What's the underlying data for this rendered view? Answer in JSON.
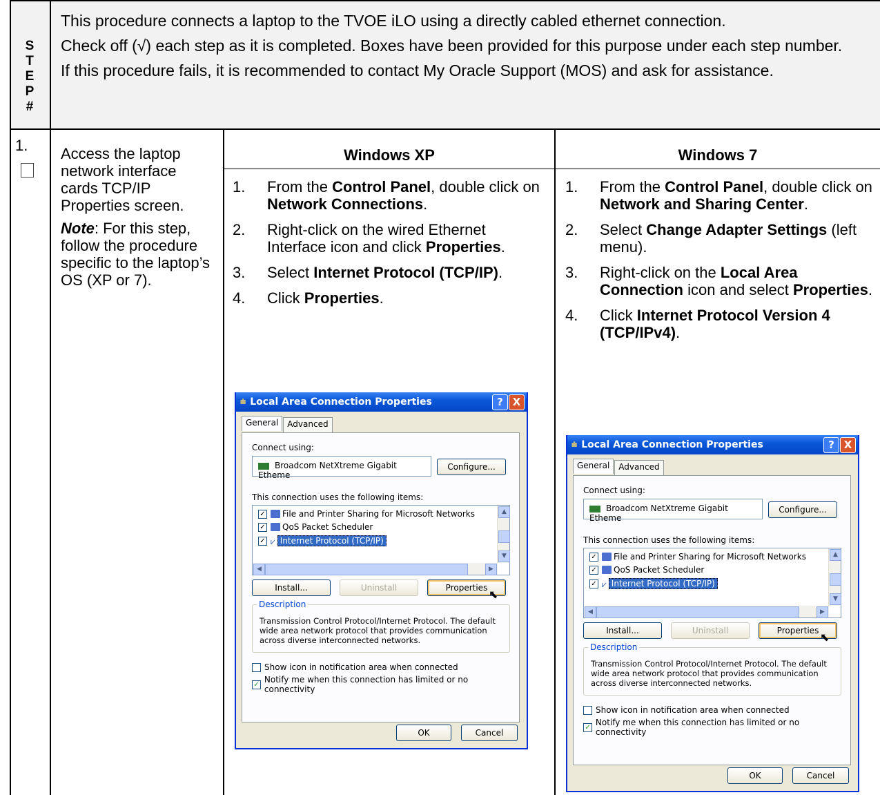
{
  "header": {
    "step_letters": [
      "S",
      "T",
      "E",
      "P",
      "#"
    ],
    "intro": [
      "This procedure connects a laptop to the TVOE iLO using a directly cabled ethernet connection.",
      "Check off (√) each step as it is completed.  Boxes have been provided for this purpose under each step number.",
      "If this procedure fails, it is recommended to contact My Oracle Support (MOS) and ask for assistance."
    ]
  },
  "step": {
    "number": "1.",
    "task": "Access the laptop network interface cards TCP/IP Properties screen.",
    "note_label": "Note",
    "note_text": ":    For this step, follow the procedure specific to the laptop’s OS (XP or 7)."
  },
  "xp": {
    "title": "Windows XP",
    "steps": [
      {
        "n": "1.",
        "parts": [
          [
            "From the ",
            false
          ],
          [
            "Control Panel",
            true
          ],
          [
            ", double click on ",
            false
          ],
          [
            "Network Connections",
            true
          ],
          [
            ".",
            false
          ]
        ]
      },
      {
        "n": "2.",
        "parts": [
          [
            "Right-click on the wired Ethernet Interface icon and click ",
            false
          ],
          [
            "Properties",
            true
          ],
          [
            ".",
            false
          ]
        ]
      },
      {
        "n": "3.",
        "parts": [
          [
            "Select ",
            false
          ],
          [
            "Internet Protocol (TCP/IP)",
            true
          ],
          [
            ".",
            false
          ]
        ]
      },
      {
        "n": "4.",
        "parts": [
          [
            "Click ",
            false
          ],
          [
            "Properties",
            true
          ],
          [
            ".",
            false
          ]
        ]
      }
    ]
  },
  "win7": {
    "title": "Windows 7",
    "steps": [
      {
        "n": "1.",
        "parts": [
          [
            "From the ",
            false
          ],
          [
            "Control Panel",
            true
          ],
          [
            ", double click on ",
            false
          ],
          [
            "Network and Sharing Center",
            true
          ],
          [
            ".",
            false
          ]
        ]
      },
      {
        "n": "2.",
        "parts": [
          [
            "Select ",
            false
          ],
          [
            "Change Adapter Settings",
            true
          ],
          [
            " (left menu).",
            false
          ]
        ]
      },
      {
        "n": "3.",
        "parts": [
          [
            "Right-click on the ",
            false
          ],
          [
            "Local Area Connection",
            true
          ],
          [
            " icon and select ",
            false
          ],
          [
            "Properties",
            true
          ],
          [
            ".",
            false
          ]
        ]
      },
      {
        "n": "4.",
        "parts": [
          [
            "Click ",
            false
          ],
          [
            "Internet Protocol Version 4 (TCP/IPv4)",
            true
          ],
          [
            ".",
            false
          ]
        ]
      }
    ]
  },
  "dialog": {
    "title": "Local Area Connection Properties",
    "help": "?",
    "close": "X",
    "tab_general": "General",
    "tab_advanced": "Advanced",
    "connect_using": "Connect using:",
    "adapter": "Broadcom NetXtreme Gigabit Etheme",
    "configure": "Configure...",
    "items_label": "This connection uses the following items:",
    "items": [
      {
        "label": "File and Printer Sharing for Microsoft Networks",
        "checked": true,
        "icon": "pc-icon"
      },
      {
        "label": "QoS Packet Scheduler",
        "checked": true,
        "icon": "pc-icon"
      },
      {
        "label": "Internet Protocol (TCP/IP)",
        "checked": true,
        "icon": "network-icon",
        "selected": true
      }
    ],
    "install": "Install...",
    "uninstall": "Uninstall",
    "properties": "Properties",
    "description_legend": "Description",
    "description": "Transmission Control Protocol/Internet Protocol. The default wide area network protocol that provides communication across diverse interconnected networks.",
    "show_icon": "Show icon in notification area when connected",
    "notify": "Notify me when this connection has limited or no connectivity",
    "ok": "OK",
    "cancel": "Cancel"
  }
}
